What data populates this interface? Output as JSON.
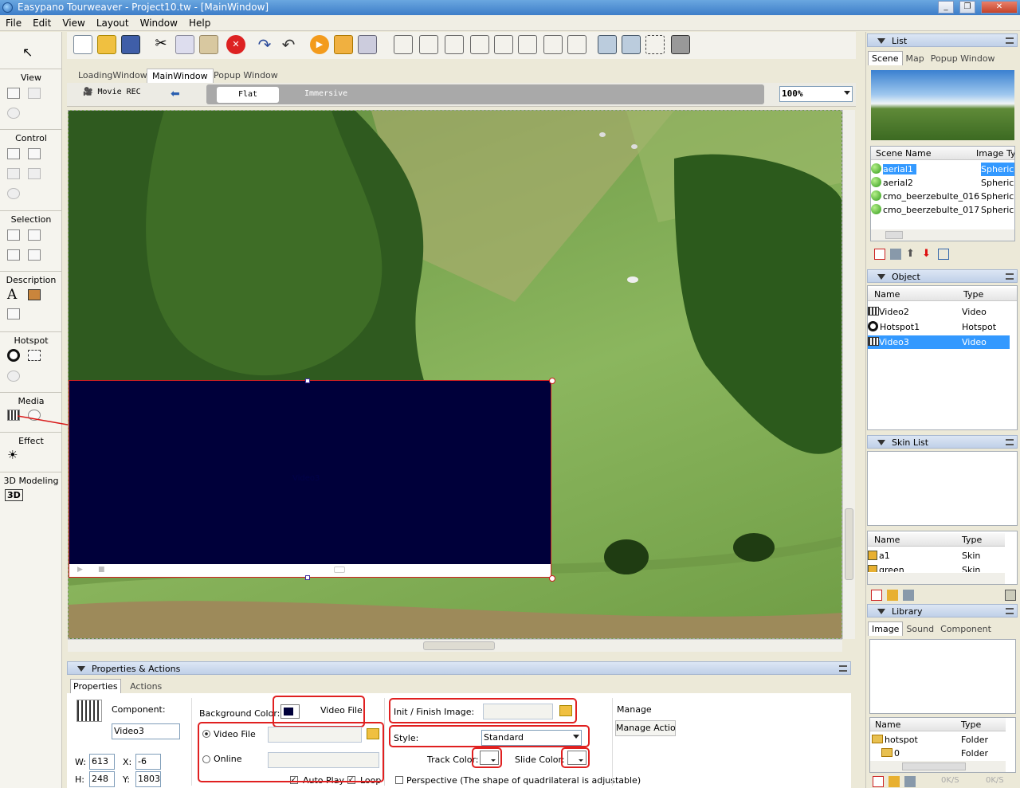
{
  "window": {
    "title": "Easypano Tourweaver - Project10.tw - [MainWindow]"
  },
  "menu": [
    "File",
    "Edit",
    "View",
    "Layout",
    "Window",
    "Help"
  ],
  "colors": {
    "accent": "#3399ff",
    "video": "#00003a",
    "red": "#e02020"
  },
  "left_panel": {
    "sections": [
      "View",
      "Control",
      "Selection",
      "Description",
      "Hotspot",
      "Media",
      "Effect",
      "3D Modeling"
    ]
  },
  "doc_tabs": [
    "LoadingWindow",
    "MainWindow",
    "Popup Window"
  ],
  "subbar": {
    "movie_rec": "Movie REC",
    "flat": "Flat",
    "immersive": "Immersive",
    "zoom": "100%"
  },
  "video": {
    "text": "Video3"
  },
  "properties": {
    "header": "Properties & Actions",
    "tabs": [
      "Properties",
      "Actions"
    ],
    "component_label": "Component:",
    "component_value": "Video3",
    "w_label": "W:",
    "w": "613",
    "x_label": "X:",
    "x": "-6",
    "h_label": "H:",
    "h": "248",
    "y_label": "Y:",
    "y": "1803",
    "bg_color_label": "Background Color:",
    "video_file_label": "Video File:",
    "video_file_radio": "Video File",
    "online_radio": "Online",
    "auto_play": "Auto Play",
    "loop": "Loop",
    "init_finish_label": "Init / Finish Image:",
    "style_label": "Style:",
    "style_value": "Standard",
    "track_color_label": "Track Color:",
    "slide_color_label": "Slide Color:",
    "perspective": "Perspective (The shape of quadrilateral is adjustable)",
    "manage_label": "Manage",
    "manage_actions": "Manage Actions"
  },
  "list_panel": {
    "header": "List",
    "tabs": [
      "Scene",
      "Map",
      "Popup Window"
    ],
    "columns": [
      "Scene Name",
      "Image Type"
    ],
    "scenes": [
      {
        "name": "aerial1",
        "type": "Spherical"
      },
      {
        "name": "aerial2",
        "type": "Spherical"
      },
      {
        "name": "cmo_beerzebulte_016",
        "type": "Spherical"
      },
      {
        "name": "cmo_beerzebulte_017",
        "type": "Spherical"
      }
    ]
  },
  "object_panel": {
    "header": "Object",
    "columns": [
      "Name",
      "Type"
    ],
    "items": [
      {
        "name": "Video2",
        "type": "Video"
      },
      {
        "name": "Hotspot1",
        "type": "Hotspot"
      },
      {
        "name": "Video3",
        "type": "Video"
      }
    ]
  },
  "skin_panel": {
    "header": "Skin List",
    "columns": [
      "Name",
      "Type"
    ],
    "items": [
      {
        "name": "a1",
        "type": "Skin"
      },
      {
        "name": "green",
        "type": "Skin"
      }
    ]
  },
  "library_panel": {
    "header": "Library",
    "tabs": [
      "Image",
      "Sound",
      "Component"
    ],
    "columns": [
      "Name",
      "Type"
    ],
    "items": [
      {
        "name": "hotspot",
        "type": "Folder"
      },
      {
        "name": "0",
        "type": "Folder"
      }
    ],
    "status": [
      "0K/S",
      "0K/S"
    ]
  }
}
